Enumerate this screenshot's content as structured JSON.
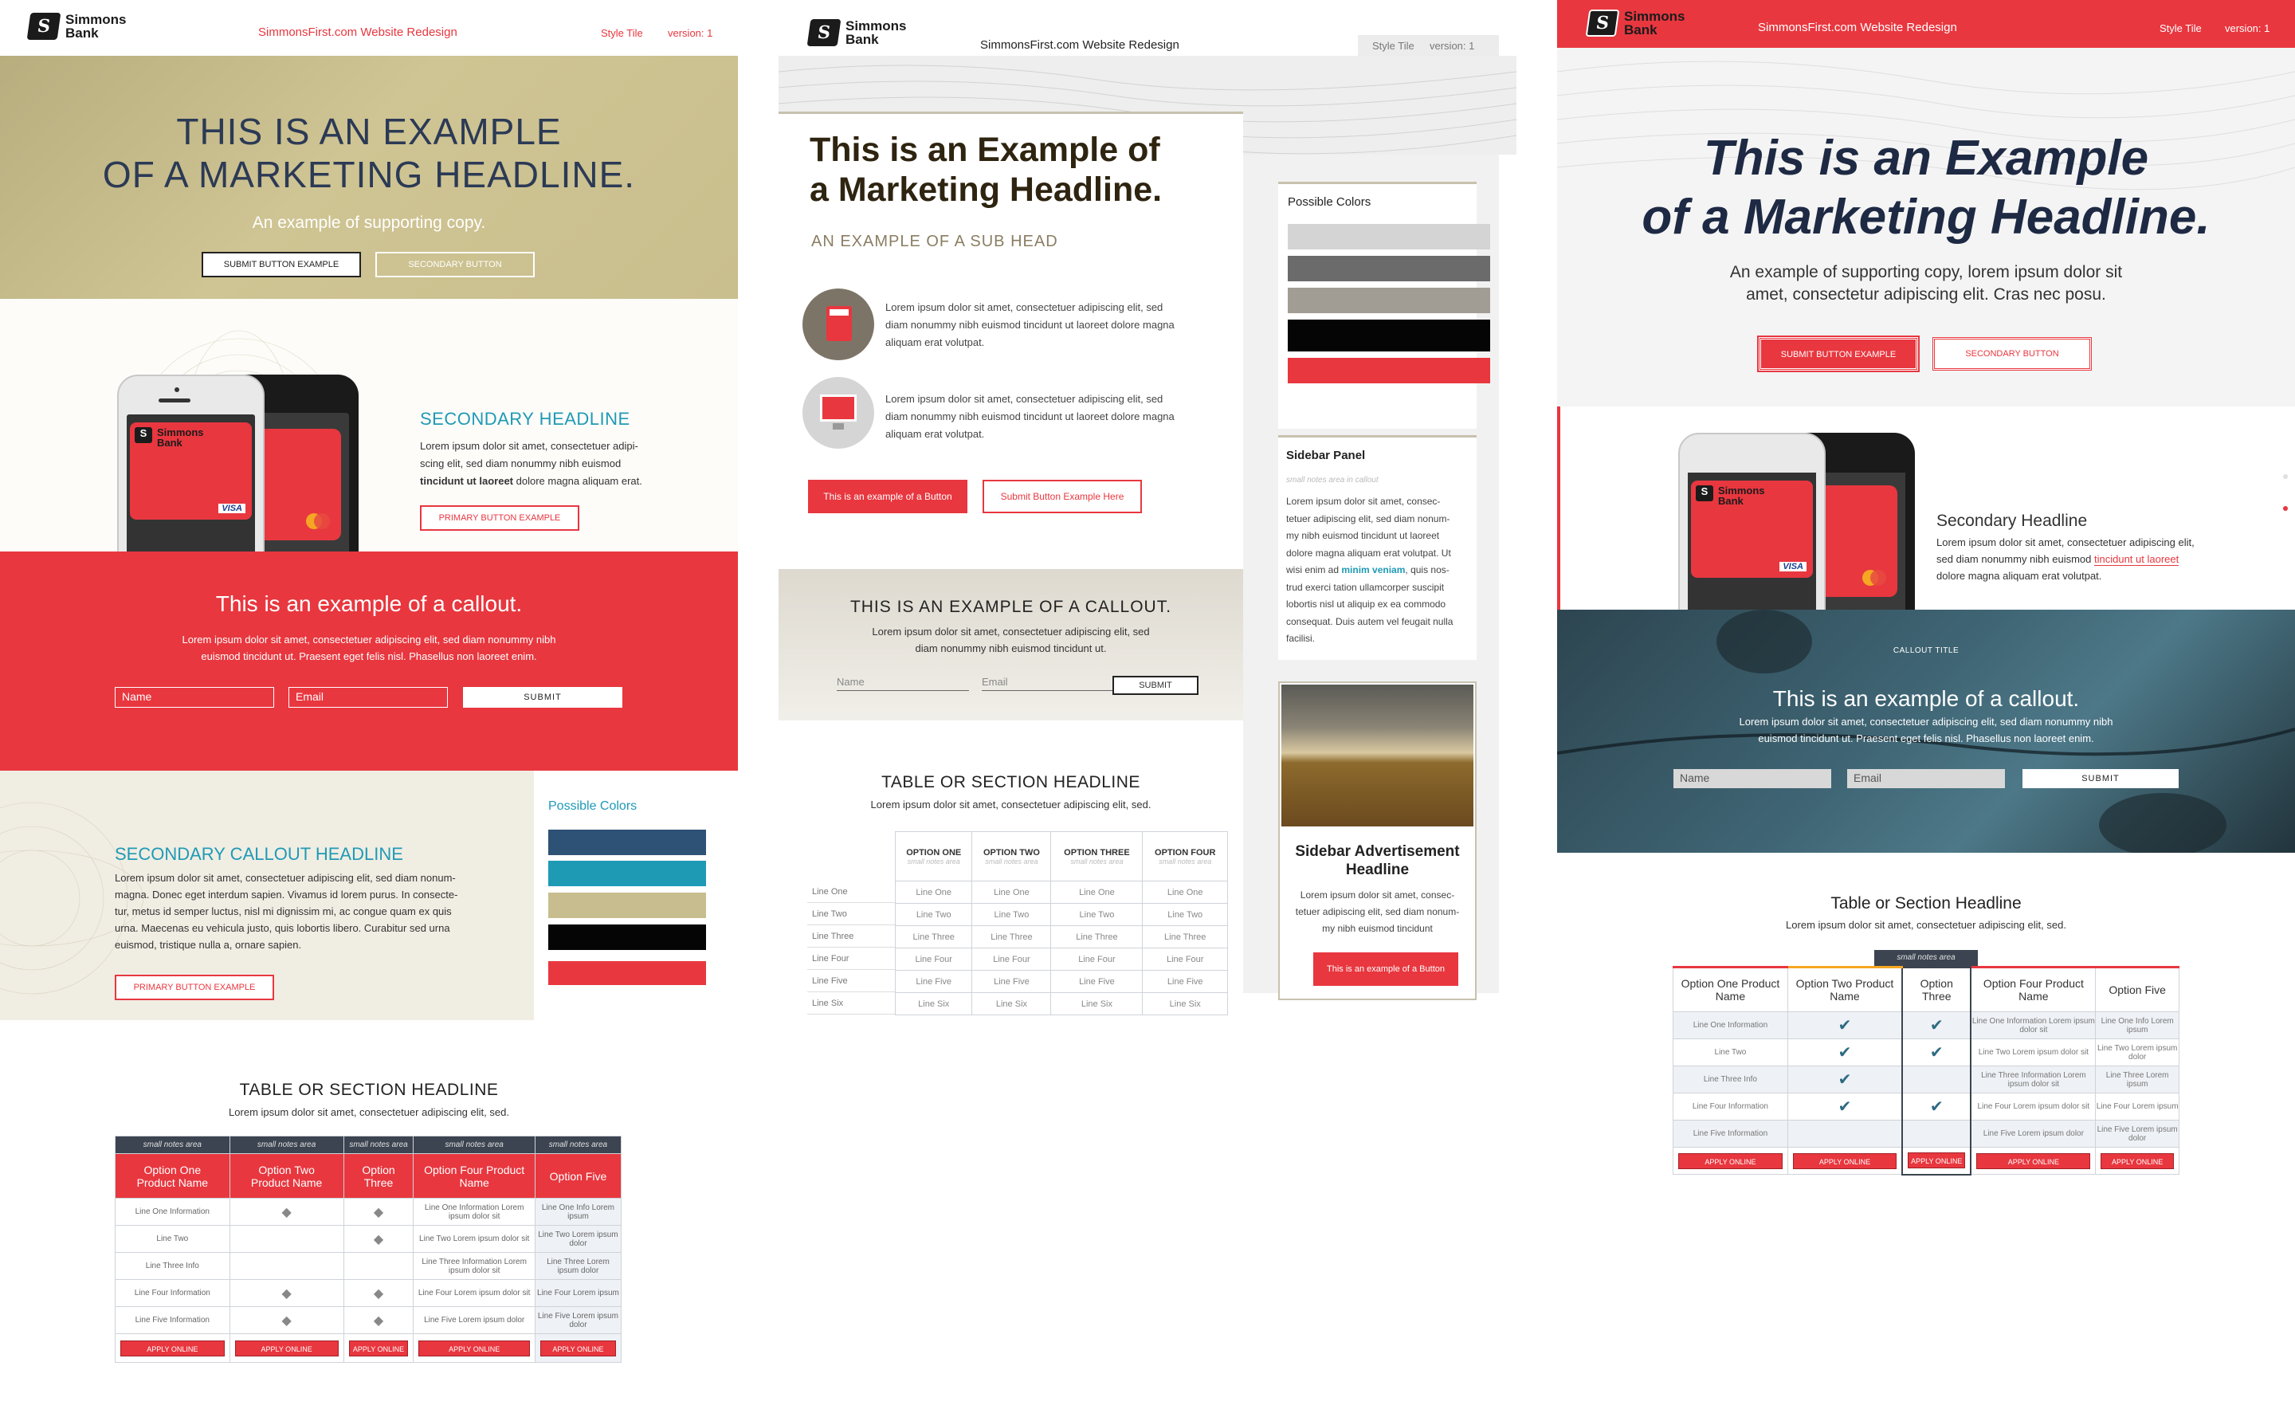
{
  "colors": {
    "brand_red": "#e8373f",
    "navy": "#1e2a44",
    "khaki": "#c8bd8e",
    "teal": "#1f9ab5",
    "slate_blue": "#2e5176"
  },
  "tile1": {
    "header": {
      "logo_line1": "Simmons",
      "logo_line2": "Bank",
      "project_title": "SimmonsFirst.com Website Redesign",
      "style_tile": "Style Tile",
      "version": "version: 1"
    },
    "hero": {
      "headline_line1": "THIS IS AN EXAMPLE",
      "headline_line2": "OF A MARKETING HEADLINE.",
      "supporting": "An example of supporting copy.",
      "submit_button": "SUBMIT BUTTON EXAMPLE",
      "secondary_button": "SECONDARY BUTTON"
    },
    "phone_section": {
      "card_brand": "Simmons",
      "card_brand2": "Bank",
      "visa": "VISA",
      "headline": "SECONDARY HEADLINE",
      "body1": "Lorem ipsum dolor sit amet, consectetuer adipi-",
      "body2": "scing elit, sed diam nonummy nibh euismod",
      "body3_bold": "tincidunt ut laoreet",
      "body3_rest": " dolore magna aliquam erat.",
      "button": "PRIMARY BUTTON EXAMPLE"
    },
    "callout": {
      "headline": "This is an example of a callout.",
      "body1": "Lorem ipsum dolor sit amet, consectetuer adipiscing elit, sed diam nonummy nibh",
      "body2": "euismod tincidunt ut. Praesent eget felis nisl. Phasellus non laoreet enim.",
      "name_placeholder": "Name",
      "email_placeholder": "Email",
      "submit": "SUBMIT"
    },
    "secondary_callout": {
      "headline": "SECONDARY CALLOUT HEADLINE",
      "lines": [
        "Lorem ipsum dolor sit amet, consectetuer adipiscing elit, sed diam nonum-",
        "magna. Donec eget interdum sapien. Vivamus id lorem purus. In consecte-",
        "tur, metus id semper luctus, nisl mi dignissim mi, ac congue quam ex quis",
        "urna. Maecenas eu vehicula justo, quis lobortis libero. Curabitur sed urna",
        "euismod, tristique nulla a, ornare sapien."
      ],
      "button": "PRIMARY BUTTON EXAMPLE"
    },
    "possible_colors": {
      "label": "Possible Colors",
      "swatches": [
        "#2e5176",
        "#1f9ab5",
        "#c8bd8e",
        "#050505",
        "#e8373f"
      ]
    },
    "table": {
      "headline": "TABLE OR SECTION HEADLINE",
      "subhead": "Lorem ipsum dolor sit amet, consectetuer adipiscing elit, sed.",
      "notes": [
        "small notes area",
        "small notes area",
        "small notes area",
        "small notes area",
        "small notes area"
      ],
      "columns": [
        "Option One Product Name",
        "Option Two Product Name",
        "Option Three",
        "Option Four Product Name",
        "Option Five"
      ],
      "rows": [
        [
          "Line One Information",
          "◆",
          "◆",
          "Line One Information Lorem ipsum dolor sit",
          "Line One Info Lorem ipsum"
        ],
        [
          "Line Two",
          "",
          "◆",
          "Line Two Lorem ipsum dolor sit",
          "Line Two Lorem ipsum dolor"
        ],
        [
          "Line Three Info",
          "",
          "",
          "Line Three Information Lorem ipsum dolor sit",
          "Line Three Lorem ipsum dolor"
        ],
        [
          "Line Four Information",
          "◆",
          "◆",
          "Line Four Lorem ipsum dolor sit",
          "Line Four Lorem ipsum"
        ],
        [
          "Line Five Information",
          "◆",
          "◆",
          "Line Five Lorem ipsum dolor",
          "Line Five Lorem ipsum dolor"
        ]
      ],
      "apply": "APPLY ONLINE"
    }
  },
  "tile2": {
    "header": {
      "logo_line1": "Simmons",
      "logo_line2": "Bank",
      "project_title": "SimmonsFirst.com Website Redesign",
      "style_tile": "Style Tile",
      "version": "version: 1"
    },
    "hero": {
      "headline_line1": "This is an Example of",
      "headline_line2": "a Marketing Headline.",
      "subhead": "AN EXAMPLE OF A SUB HEAD"
    },
    "features": [
      {
        "icon": "calculator-icon",
        "lines": [
          "Lorem ipsum dolor sit amet, consectetuer adipiscing elit, sed",
          "diam nonummy nibh euismod tincidunt ut laoreet dolore magna",
          "aliquam erat volutpat."
        ]
      },
      {
        "icon": "computer-click-icon",
        "lines": [
          "Lorem ipsum dolor sit amet, consectetuer adipiscing elit, sed",
          "diam nonummy nibh euismod tincidunt ut laoreet dolore magna",
          "aliquam erat volutpat."
        ]
      }
    ],
    "button1": "This is an example of a Button",
    "button2": "Submit Button Example Here",
    "callout": {
      "headline": "THIS IS AN EXAMPLE OF A CALLOUT.",
      "body1": "Lorem ipsum dolor sit amet, consectetuer adipiscing elit, sed",
      "body2": "diam nonummy nibh euismod tincidunt ut.",
      "name_placeholder": "Name",
      "email_placeholder": "Email",
      "submit": "SUBMIT"
    },
    "table": {
      "headline": "TABLE OR SECTION HEADLINE",
      "subhead": "Lorem ipsum dolor sit amet, consectetuer adipiscing elit, sed.",
      "columns": [
        "OPTION ONE",
        "OPTION TWO",
        "OPTION THREE",
        "OPTION FOUR"
      ],
      "notes": "small notes area",
      "row_labels": [
        "Line One",
        "Line Two",
        "Line Three",
        "Line Four",
        "Line Five",
        "Line Six"
      ]
    },
    "sidebar": {
      "colors_label": "Possible Colors",
      "swatches": [
        "#d4d4d4",
        "#6b6b6b",
        "#a29d94",
        "#050505",
        "#e8373f"
      ],
      "panel_title": "Sidebar Panel",
      "panel_notes": "small notes area in callout",
      "panel_lines": [
        "Lorem ipsum dolor sit amet, consec-",
        "tetuer adipiscing elit, sed diam nonum-",
        "my nibh euismod tincidunt ut laoreet",
        "dolore magna aliquam erat volutpat. Ut",
        "wisi enim ad",
        "minim veniam",
        ", quis nos-",
        "trud exerci tation ullamcorper suscipit",
        "lobortis nisl ut aliquip ex ea commodo",
        "consequat. Duis autem vel feugait nulla",
        "facilisi."
      ],
      "ad_headline1": "Sidebar Advertisement",
      "ad_headline2": "Headline",
      "ad_lines": [
        "Lorem ipsum dolor sit amet, consec-",
        "tetuer adipiscing elit, sed diam nonum-",
        "my nibh euismod tincidunt"
      ],
      "ad_button": "This is an example of a Button"
    }
  },
  "tile3": {
    "header": {
      "logo_line1": "Simmons",
      "logo_line2": "Bank",
      "project_title": "SimmonsFirst.com Website Redesign",
      "style_tile": "Style Tile",
      "version": "version: 1"
    },
    "hero": {
      "headline_line1": "This is an Example",
      "headline_line2": "of a Marketing Headline.",
      "supporting1": "An example of supporting copy, lorem ipsum dolor sit",
      "supporting2": "amet, consectetur adipiscing elit. Cras nec posu.",
      "submit_button": "SUBMIT BUTTON EXAMPLE",
      "secondary_button": "SECONDARY BUTTON"
    },
    "phone_section": {
      "headline": "Secondary Headline",
      "body1": "Lorem ipsum dolor sit amet, consectetuer adipiscing elit,",
      "body2a": "sed diam nonummy nibh euismod ",
      "body2_link": "tincidunt ut laoreet",
      "body3": "dolore magna aliquam erat volutpat."
    },
    "callout": {
      "title": "CALLOUT TITLE",
      "headline": "This is an example of a callout.",
      "body1": "Lorem ipsum dolor sit amet, consectetuer adipiscing elit, sed diam nonummy nibh",
      "body2": "euismod tincidunt ut. Praesent eget felis nisl. Phasellus non laoreet enim.",
      "name_placeholder": "Name",
      "email_placeholder": "Email",
      "submit": "SUBMIT"
    },
    "table": {
      "headline": "Table or Section Headline",
      "subhead": "Lorem ipsum dolor sit amet, consectetuer adipiscing elit, sed.",
      "notes": "small notes area",
      "columns": [
        "Option One Product Name",
        "Option Two Product Name",
        "Option Three",
        "Option Four Product Name",
        "Option Five"
      ],
      "rows": [
        [
          "Line One Information",
          "✔",
          "✔",
          "Line One Information Lorem ipsum dolor sit",
          "Line One Info Lorem ipsum"
        ],
        [
          "Line Two",
          "✔",
          "✔",
          "Line Two Lorem ipsum dolor sit",
          "Line Two Lorem ipsum dolor"
        ],
        [
          "Line Three Info",
          "✔",
          "",
          "Line Three Information Lorem ipsum dolor sit",
          "Line Three Lorem ipsum"
        ],
        [
          "Line Four Information",
          "✔",
          "✔",
          "Line Four Lorem ipsum dolor sit",
          "Line Four Lorem ipsum"
        ],
        [
          "Line Five Information",
          "",
          "",
          "Line Five Lorem ipsum dolor",
          "Line Five Lorem ipsum dolor"
        ]
      ],
      "apply": "APPLY ONLINE"
    }
  }
}
